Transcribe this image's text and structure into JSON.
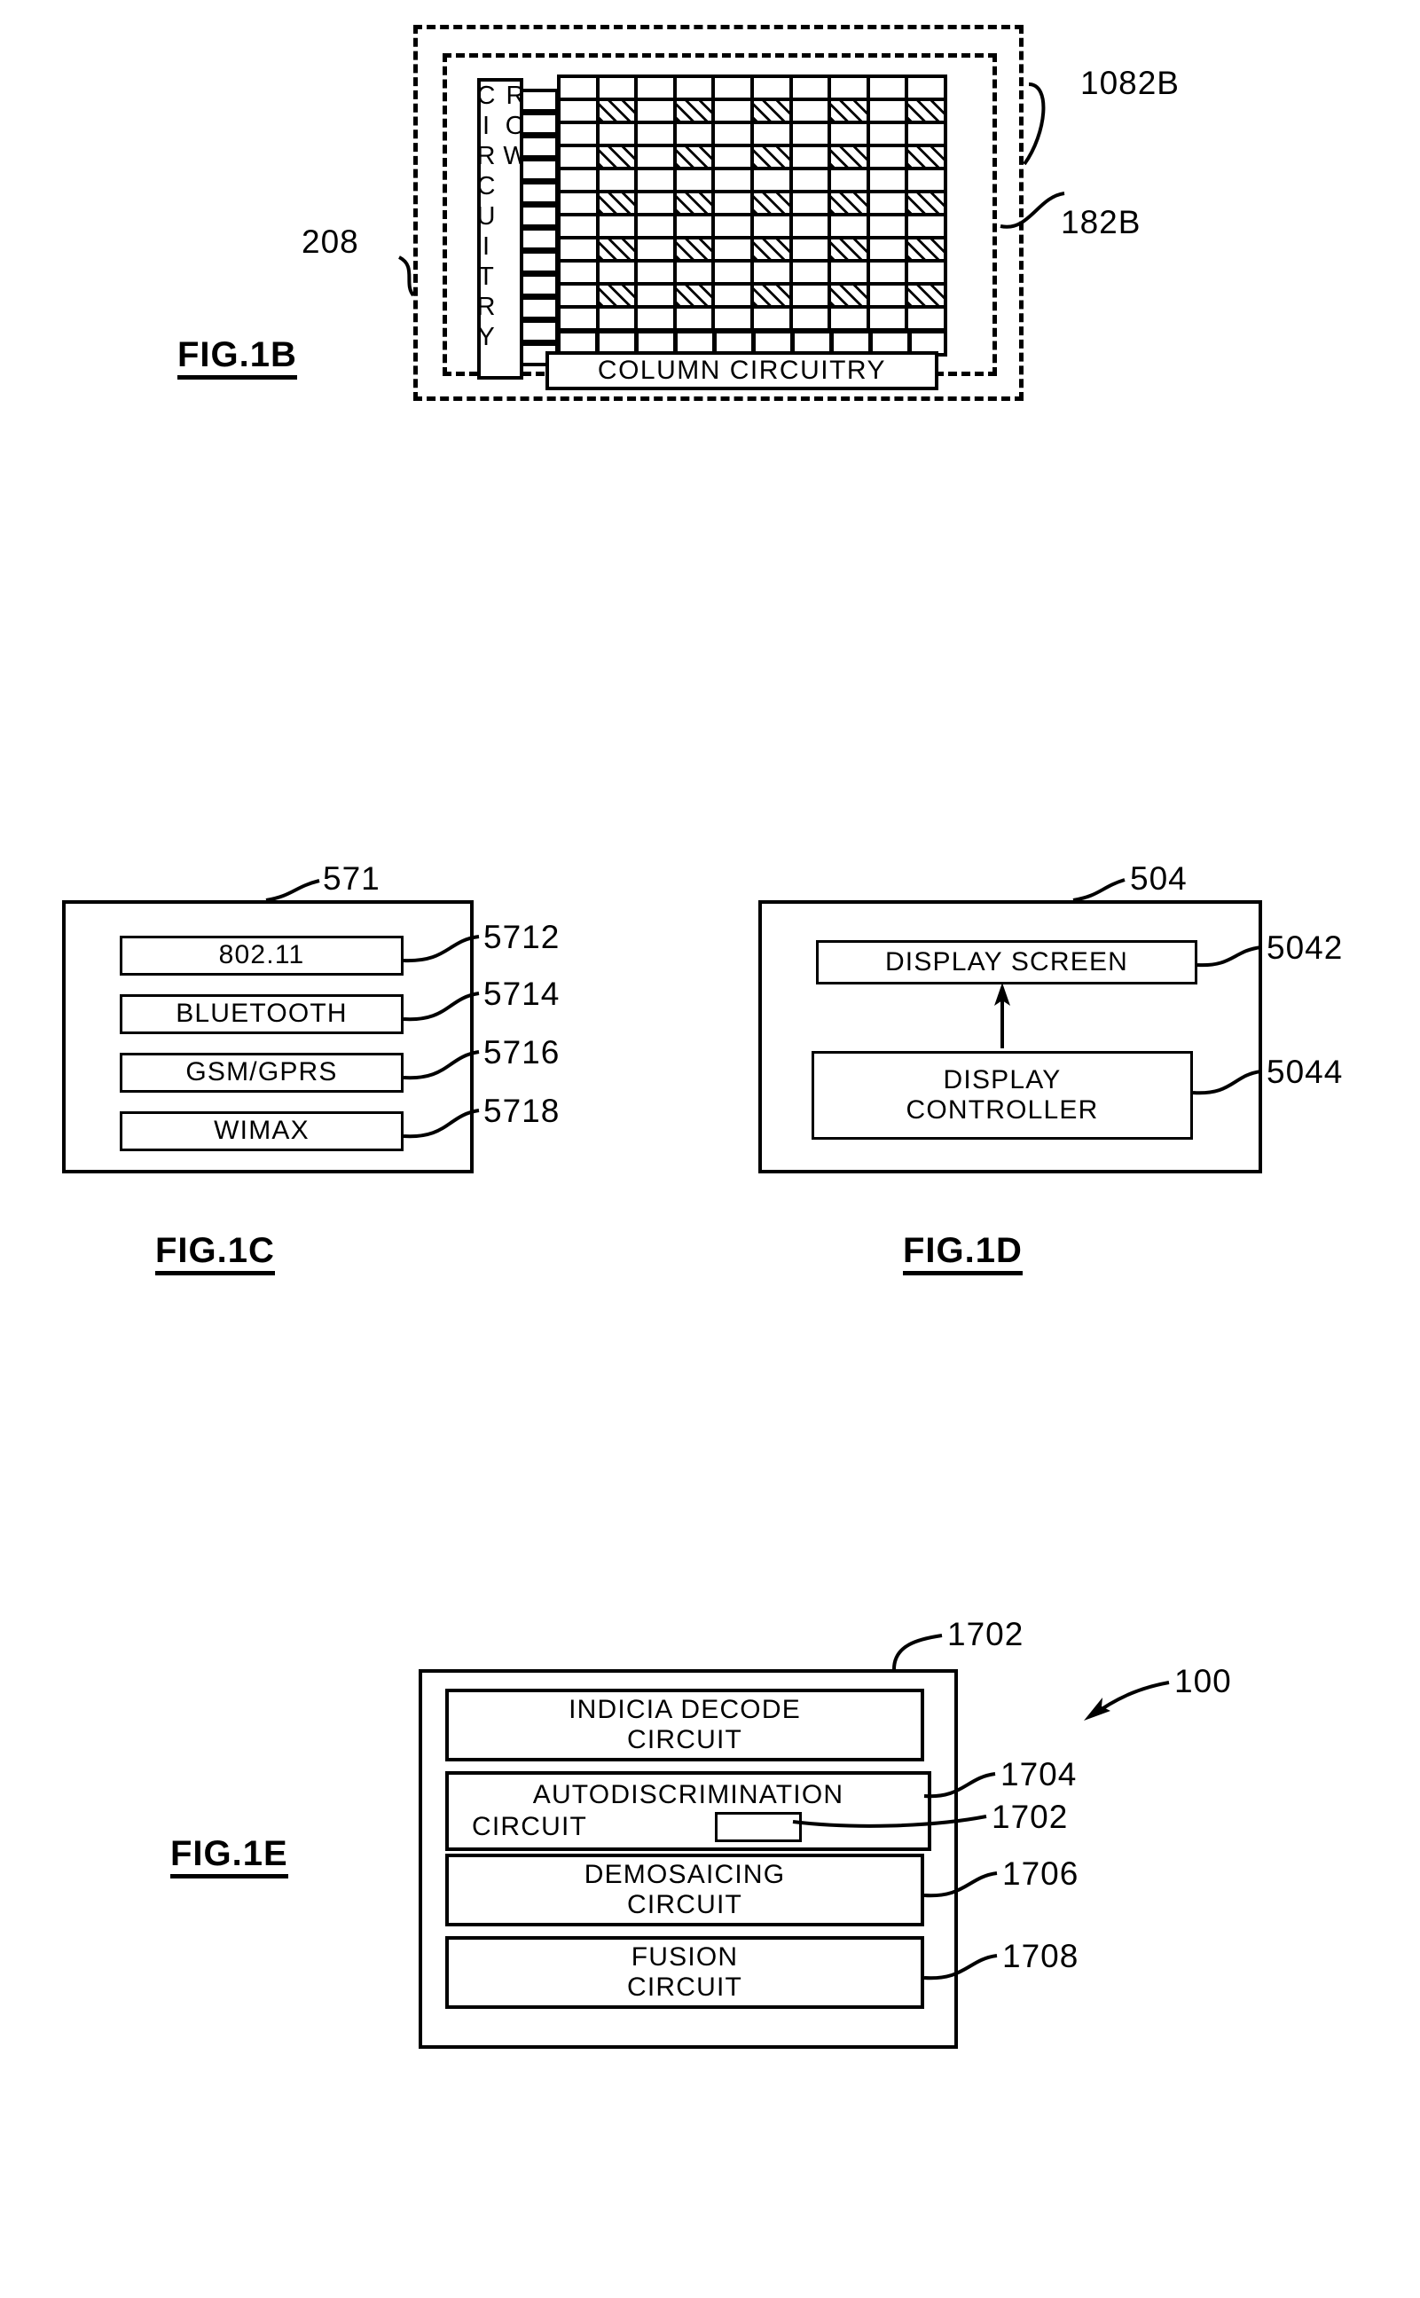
{
  "figures": [
    {
      "id": "fig1b",
      "label": "FIG.1B",
      "outer_ref": "208",
      "refs": [
        {
          "id": "1082B",
          "text": "1082B"
        },
        {
          "id": "182B",
          "text": "182B"
        }
      ],
      "row_circuitry_label": "ROW CIRCUITRY",
      "column_circuitry_label": "COLUMN  CIRCUITRY",
      "grid": {
        "columns": 10,
        "rows": 11,
        "hatched_rows": [
          1,
          3,
          5,
          7,
          9
        ],
        "hatched_columns": [
          1,
          3,
          5,
          7,
          9
        ]
      }
    },
    {
      "id": "fig1c",
      "label": "FIG.1C",
      "container_ref": "571",
      "items": [
        {
          "label": "802.11",
          "ref": "5712"
        },
        {
          "label": "BLUETOOTH",
          "ref": "5714"
        },
        {
          "label": "GSM/GPRS",
          "ref": "5716"
        },
        {
          "label": "WIMAX",
          "ref": "5718"
        }
      ]
    },
    {
      "id": "fig1d",
      "label": "FIG.1D",
      "container_ref": "504",
      "items": [
        {
          "label": "DISPLAY  SCREEN",
          "ref": "5042"
        },
        {
          "label": "DISPLAY\nCONTROLLER",
          "ref": "5044"
        }
      ]
    },
    {
      "id": "fig1e",
      "label": "FIG.1E",
      "container_ref": "1702",
      "assembly_ref": "100",
      "items": [
        {
          "label": "INDICIA  DECODE\nCIRCUIT",
          "ref": "1704"
        },
        {
          "label": "AUTODISCRIMINATION\nCIRCUIT",
          "ref": "1702"
        },
        {
          "label": "DEMOSAICING\nCIRCUIT",
          "ref": "1706"
        },
        {
          "label": "FUSION\nCIRCUIT",
          "ref": "1708"
        }
      ]
    }
  ],
  "fig1b": {
    "label": "FIG.1B",
    "ref_208": "208",
    "ref_1082B": "1082B",
    "ref_182B": "182B",
    "row_text": "ROW CIRCUITRY",
    "column_text": "COLUMN  CIRCUITRY"
  },
  "fig1c": {
    "label": "FIG.1C",
    "ref_571": "571",
    "item1": "802.11",
    "item1_ref": "5712",
    "item2": "BLUETOOTH",
    "item2_ref": "5714",
    "item3": "GSM/GPRS",
    "item3_ref": "5716",
    "item4": "WIMAX",
    "item4_ref": "5718"
  },
  "fig1d": {
    "label": "FIG.1D",
    "ref_504": "504",
    "screen": "DISPLAY  SCREEN",
    "screen_ref": "5042",
    "controller_line1": "DISPLAY",
    "controller_line2": "CONTROLLER",
    "controller_ref": "5044"
  },
  "fig1e": {
    "label": "FIG.1E",
    "ref_1702_top": "1702",
    "ref_100": "100",
    "b1_line1": "INDICIA  DECODE",
    "b1_line2": "CIRCUIT",
    "b1_ref": "1704",
    "b2_line1": "AUTODISCRIMINATION",
    "b2_line2": "CIRCUIT",
    "b2_ref": "1702",
    "b3_line1": "DEMOSAICING",
    "b3_line2": "CIRCUIT",
    "b3_ref": "1706",
    "b4_line1": "FUSION",
    "b4_line2": "CIRCUIT",
    "b4_ref": "1708"
  }
}
